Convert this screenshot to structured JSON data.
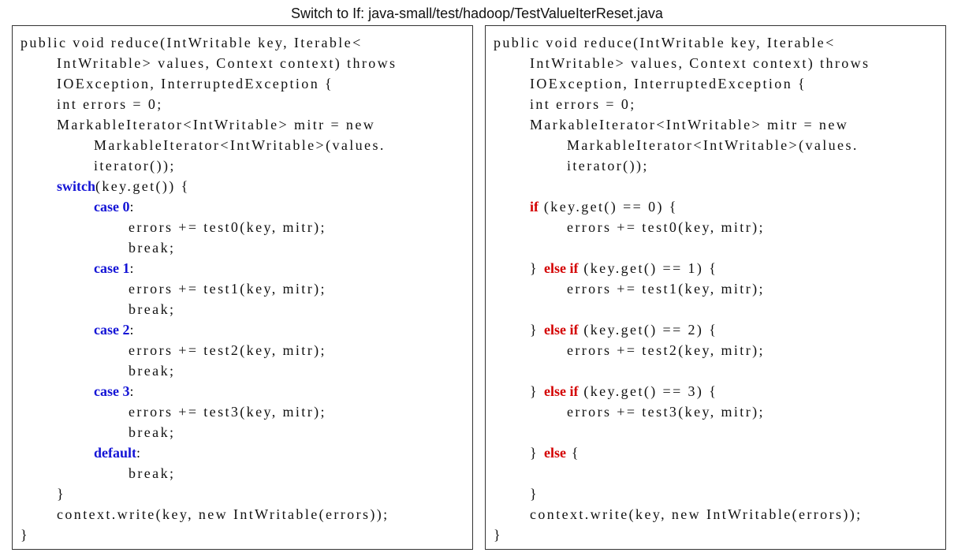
{
  "title": "Switch to If: java-small/test/hadoop/TestValueIterReset.java",
  "colors": {
    "switch_keyword": "#1414d6",
    "if_keyword": "#d40000",
    "text": "#111111",
    "border": "#333333"
  },
  "left_panel": {
    "lines": [
      [
        {
          "t": "public void reduce(IntWritable key, Iterable<"
        }
      ],
      [
        {
          "t": "IntWritable> values, Context context) throws"
        }
      ],
      [
        {
          "t": "IOException, InterruptedException {"
        }
      ],
      [
        {
          "t": "int errors = 0;"
        }
      ],
      [
        {
          "t": "MarkableIterator<IntWritable> mitr = new"
        }
      ],
      [
        {
          "t": "MarkableIterator<IntWritable>(values."
        }
      ],
      [
        {
          "t": "iterator());"
        }
      ],
      [
        {
          "t": "switch",
          "k": "kw-blue"
        },
        {
          "t": "(key.get()) {"
        }
      ],
      [
        {
          "t": "case 0",
          "k": "kw-blue"
        },
        {
          "t": ":"
        }
      ],
      [
        {
          "t": "errors += test0(key, mitr);"
        }
      ],
      [
        {
          "t": "break;"
        }
      ],
      [
        {
          "t": "case 1",
          "k": "kw-blue"
        },
        {
          "t": ":"
        }
      ],
      [
        {
          "t": "errors += test1(key, mitr);"
        }
      ],
      [
        {
          "t": "break;"
        }
      ],
      [
        {
          "t": "case 2",
          "k": "kw-blue"
        },
        {
          "t": ":"
        }
      ],
      [
        {
          "t": "errors += test2(key, mitr);"
        }
      ],
      [
        {
          "t": "break;"
        }
      ],
      [
        {
          "t": "case 3",
          "k": "kw-blue"
        },
        {
          "t": ":"
        }
      ],
      [
        {
          "t": "errors += test3(key, mitr);"
        }
      ],
      [
        {
          "t": "break;"
        }
      ],
      [
        {
          "t": "default",
          "k": "kw-blue"
        },
        {
          "t": ":"
        }
      ],
      [
        {
          "t": "break;"
        }
      ],
      [
        {
          "t": "}"
        }
      ],
      [
        {
          "t": "context.write(key, new IntWritable(errors));"
        }
      ],
      [
        {
          "t": "}"
        }
      ]
    ]
  },
  "right_panel": {
    "lines": [
      [
        {
          "t": "public void reduce(IntWritable key, Iterable<"
        }
      ],
      [
        {
          "t": "IntWritable> values, Context context) throws"
        }
      ],
      [
        {
          "t": "IOException, InterruptedException {"
        }
      ],
      [
        {
          "t": "int errors = 0;"
        }
      ],
      [
        {
          "t": "MarkableIterator<IntWritable> mitr = new"
        }
      ],
      [
        {
          "t": "MarkableIterator<IntWritable>(values."
        }
      ],
      [
        {
          "t": "iterator());"
        }
      ],
      [
        {
          "t": ""
        }
      ],
      [
        {
          "t": "if",
          "k": "kw-red"
        },
        {
          "t": " (key.get() == 0) {"
        }
      ],
      [
        {
          "t": "errors += test0(key, mitr);"
        }
      ],
      [
        {
          "t": ""
        }
      ],
      [
        {
          "t": "} "
        },
        {
          "t": "else if",
          "k": "kw-red"
        },
        {
          "t": " (key.get() == 1) {"
        }
      ],
      [
        {
          "t": "errors += test1(key, mitr);"
        }
      ],
      [
        {
          "t": ""
        }
      ],
      [
        {
          "t": "} "
        },
        {
          "t": "else if",
          "k": "kw-red"
        },
        {
          "t": " (key.get() == 2) {"
        }
      ],
      [
        {
          "t": "errors += test2(key, mitr);"
        }
      ],
      [
        {
          "t": ""
        }
      ],
      [
        {
          "t": "} "
        },
        {
          "t": "else if",
          "k": "kw-red"
        },
        {
          "t": " (key.get() == 3) {"
        }
      ],
      [
        {
          "t": "errors += test3(key, mitr);"
        }
      ],
      [
        {
          "t": ""
        }
      ],
      [
        {
          "t": "} "
        },
        {
          "t": "else",
          "k": "kw-red"
        },
        {
          "t": " {"
        }
      ],
      [
        {
          "t": ""
        }
      ],
      [
        {
          "t": "}"
        }
      ],
      [
        {
          "t": "context.write(key, new IntWritable(errors));"
        }
      ],
      [
        {
          "t": "}"
        }
      ]
    ]
  }
}
